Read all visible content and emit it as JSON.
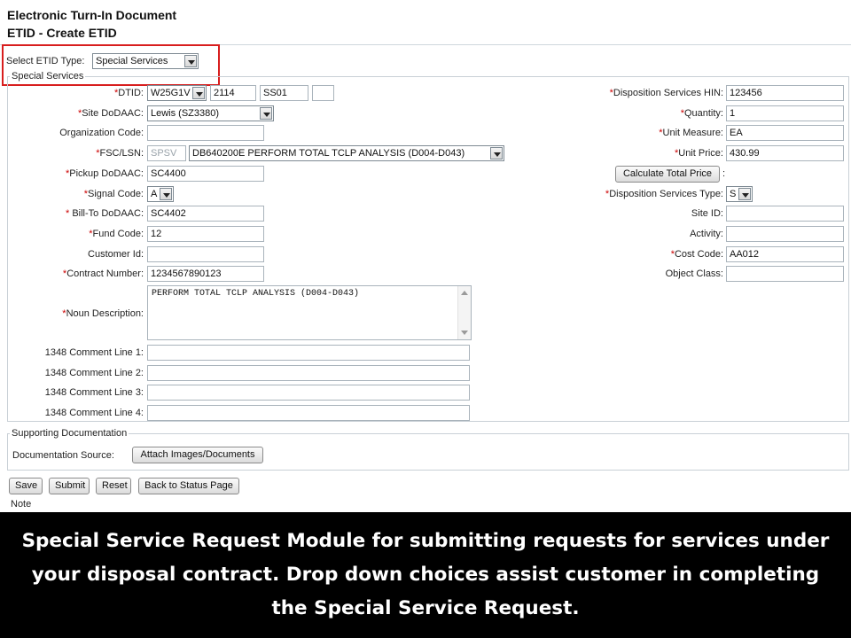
{
  "header": {
    "title": "Electronic Turn-In Document",
    "subtitle": "ETID - Create ETID"
  },
  "etid_type": {
    "label": "Select ETID Type:",
    "value": "Special Services"
  },
  "section_legend": "Special Services",
  "left_fields": {
    "dtid": {
      "label": "DTID:",
      "prefix": "W25G1V",
      "julian": "2114",
      "serial": "SS01",
      "suffix": ""
    },
    "site_dodaac": {
      "label": "Site DoDAAC:",
      "value": "Lewis (SZ3380)"
    },
    "org_code": {
      "label": "Organization Code:",
      "value": ""
    },
    "fsc_lsn": {
      "label": "FSC/LSN:",
      "fsc": "SPSV",
      "lsn": "DB640200E PERFORM TOTAL TCLP ANALYSIS (D004-D043)"
    },
    "pickup_dodaac": {
      "label": "Pickup DoDAAC:",
      "value": "SC4400"
    },
    "signal_code": {
      "label": "Signal Code:",
      "value": "A"
    },
    "bill_to_dodaac": {
      "label": "Bill-To DoDAAC:",
      "value": "SC4402"
    },
    "fund_code": {
      "label": "Fund Code:",
      "value": "12"
    },
    "customer_id": {
      "label": "Customer Id:",
      "value": ""
    },
    "contract_number": {
      "label": "Contract Number:",
      "value": "1234567890123"
    },
    "noun_description": {
      "label": "Noun Description:",
      "value": "PERFORM TOTAL TCLP ANALYSIS (D004-D043)"
    },
    "comments": [
      {
        "label": "1348 Comment Line 1:",
        "value": ""
      },
      {
        "label": "1348 Comment Line 2:",
        "value": ""
      },
      {
        "label": "1348 Comment Line 3:",
        "value": ""
      },
      {
        "label": "1348 Comment Line 4:",
        "value": ""
      }
    ]
  },
  "right_fields": {
    "ds_hin": {
      "label": "Disposition Services HIN:",
      "value": "123456"
    },
    "quantity": {
      "label": "Quantity:",
      "value": "1"
    },
    "unit_measure": {
      "label": "Unit Measure:",
      "value": "EA"
    },
    "unit_price": {
      "label": "Unit Price:",
      "value": "430.99"
    },
    "calc_button": "Calculate Total Price",
    "calc_colon": ":",
    "ds_type": {
      "label": "Disposition Services Type:",
      "value": "S"
    },
    "site_id": {
      "label": "Site ID:",
      "value": ""
    },
    "activity": {
      "label": "Activity:",
      "value": ""
    },
    "cost_code": {
      "label": "Cost Code:",
      "value": "AA012"
    },
    "object_class": {
      "label": "Object Class:",
      "value": ""
    }
  },
  "required_mark": "*",
  "supporting_docs": {
    "legend": "Supporting Documentation",
    "source_label": "Documentation Source:",
    "attach_button": "Attach Images/Documents"
  },
  "actions": {
    "save": "Save",
    "submit": "Submit",
    "reset": "Reset",
    "back": "Back to Status Page"
  },
  "note_partial": "Note",
  "caption": "Special Service Request Module for submitting requests for services under your disposal contract.  Drop down choices assist customer in completing the Special Service Request."
}
